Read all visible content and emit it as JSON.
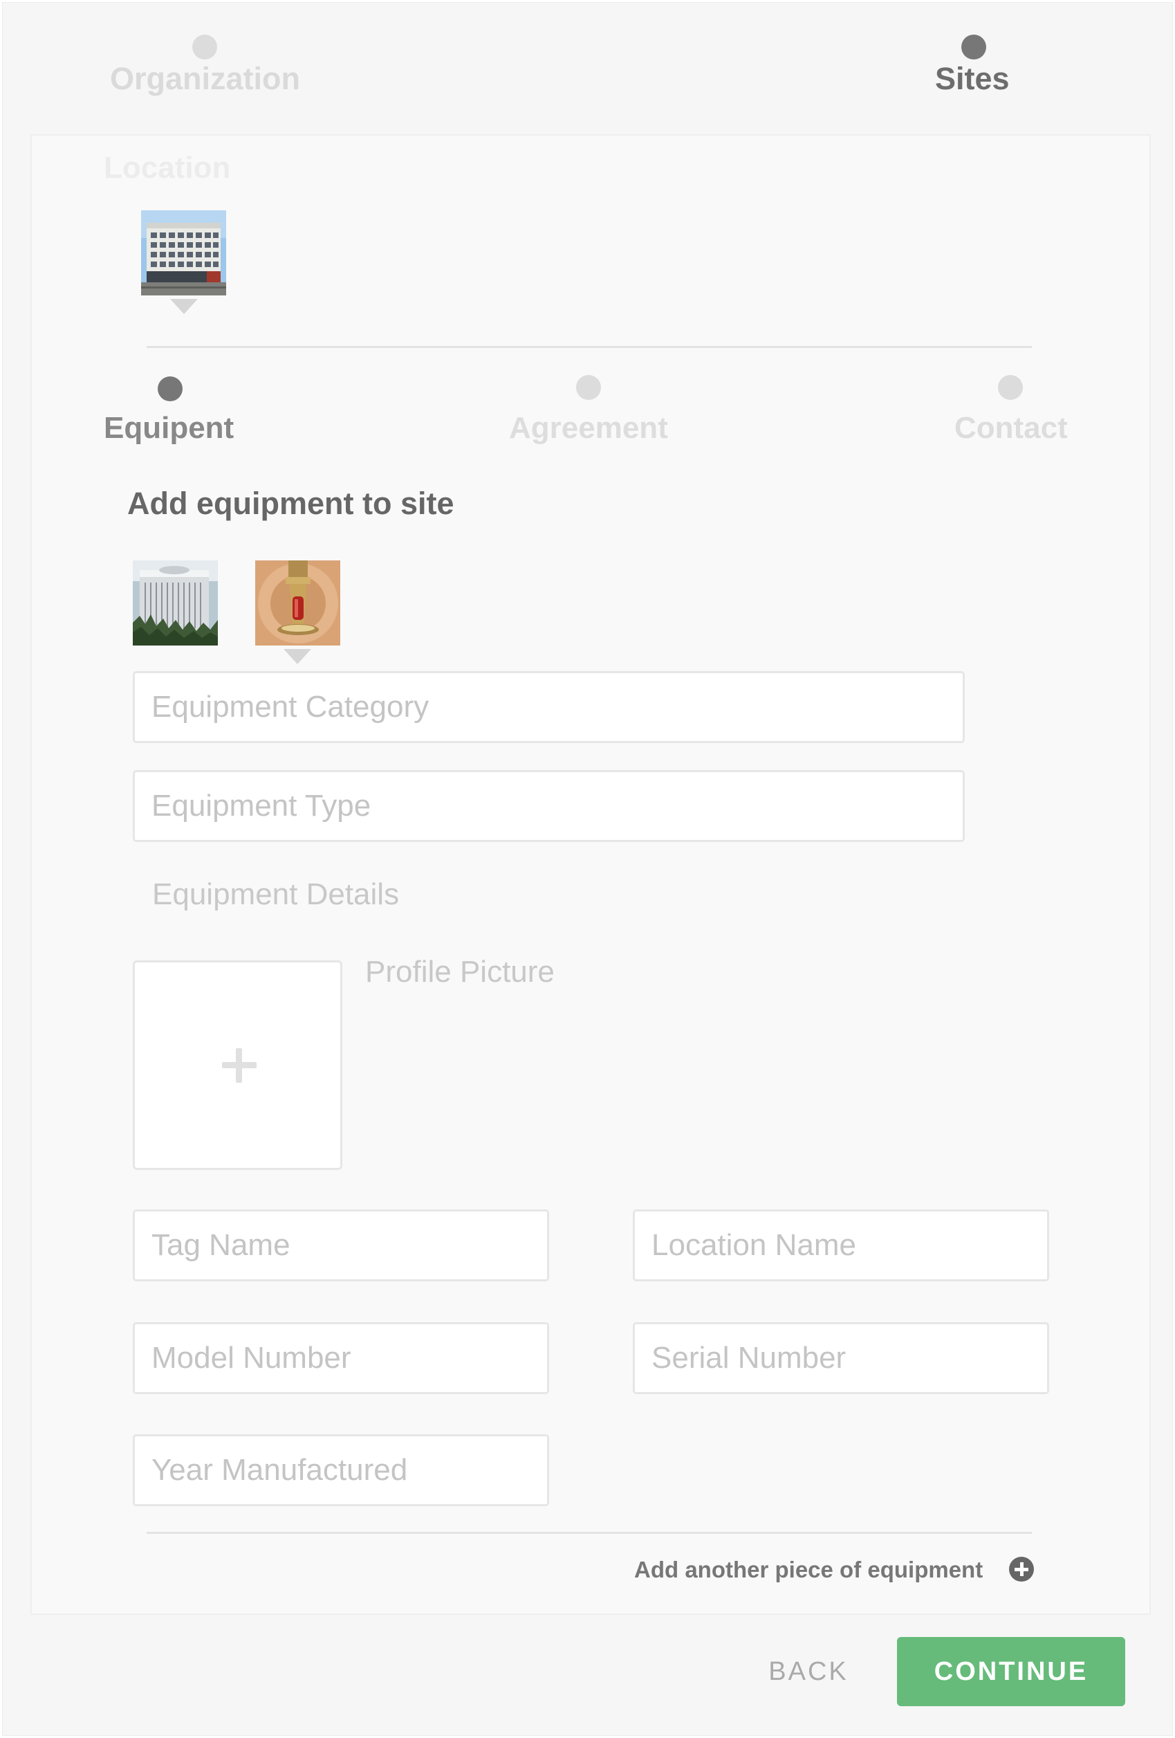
{
  "wizard": {
    "steps": [
      {
        "label": "Organization",
        "state": "inactive"
      },
      {
        "label": "Sites",
        "state": "active"
      }
    ]
  },
  "location": {
    "label": "Location",
    "thumbnail_icon": "building-photo"
  },
  "substeps": [
    {
      "label": "Equipent",
      "state": "active"
    },
    {
      "label": "Agreement",
      "state": "inactive"
    },
    {
      "label": "Contact",
      "state": "inactive"
    }
  ],
  "equipment": {
    "heading": "Add equipment to site",
    "thumbnails": [
      {
        "icon": "hvac-unit-photo"
      },
      {
        "icon": "fire-sprinkler-photo",
        "selected": true
      }
    ],
    "category_placeholder": "Equipment Category",
    "type_placeholder": "Equipment Type",
    "details_label": "Equipment Details",
    "profile_picture_label": "Profile Picture",
    "tag_name_placeholder": "Tag Name",
    "location_name_placeholder": "Location Name",
    "model_number_placeholder": "Model Number",
    "serial_number_placeholder": "Serial Number",
    "year_manufactured_placeholder": "Year Manufactured",
    "add_another_label": "Add another piece of equipment"
  },
  "footer": {
    "back_label": "BACK",
    "continue_label": "CONTINUE"
  },
  "colors": {
    "accent_green": "#66bb7a",
    "active_dot": "#777777",
    "inactive_dot": "#dcdcdc"
  }
}
